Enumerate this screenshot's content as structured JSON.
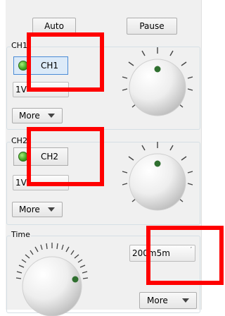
{
  "toolbar": {
    "auto_label": "Auto",
    "pause_label": "Pause"
  },
  "ch1": {
    "group_label": "CH1",
    "toggle_label": "CH1",
    "volts_value": "1V",
    "more_label": "More"
  },
  "ch2": {
    "group_label": "CH2",
    "toggle_label": "CH2",
    "volts_value": "1V",
    "more_label": "More"
  },
  "time": {
    "group_label": "Time",
    "timebase_value": "200m",
    "timebase_overlay": "5m",
    "more_label": "More"
  },
  "colors": {
    "led_green": "#3ea21e",
    "indicator_dot": "#2f6f2f",
    "annotation_red": "#ff0000",
    "selected_border": "#4a8bd6"
  },
  "icons": {
    "led": "led-green-icon",
    "dropdown": "chevron-down-icon",
    "knob": "rotary-knob-icon"
  }
}
